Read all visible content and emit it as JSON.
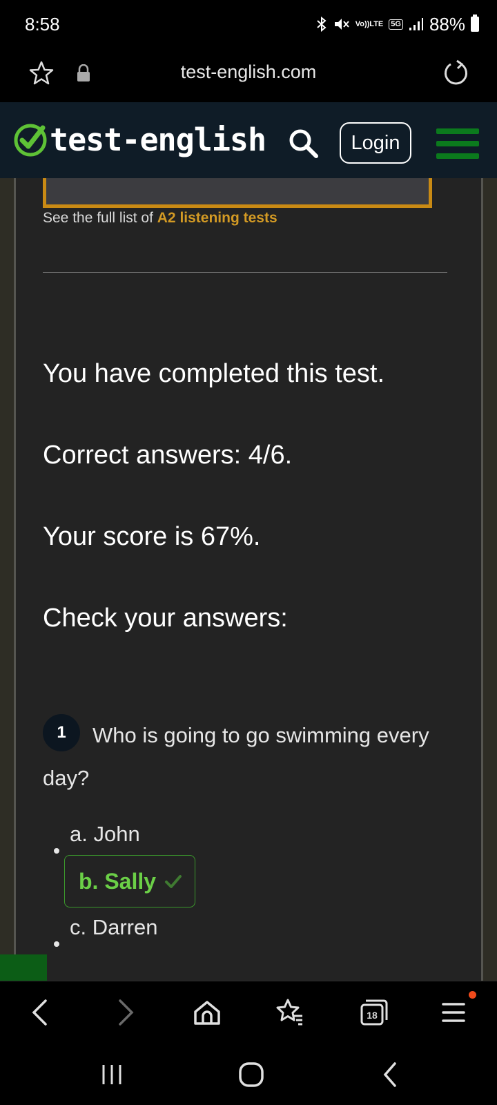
{
  "status_bar": {
    "time": "8:58",
    "volte_line1": "Vo))",
    "volte_line2": "LTE",
    "network": "5G",
    "battery": "88%"
  },
  "browser": {
    "url": "test-english.com",
    "tab_count": "18"
  },
  "header": {
    "logo_text": "test-english",
    "login_label": "Login",
    "accent_color": "#0b7a1d"
  },
  "content": {
    "see_list_prefix": "See the full list of ",
    "see_list_link": "A2 listening tests",
    "completed": "You have completed this test.",
    "correct_answers": "Correct answers: 4/6.",
    "score": "Your score is 67%.",
    "check_answers": "Check your answers:",
    "score_percent": 67
  },
  "question": {
    "number": "1",
    "text": "Who is going to go swimming every day?",
    "options": [
      {
        "label": "a. John",
        "state": "neutral"
      },
      {
        "label": "b. Sally",
        "state": "correct"
      },
      {
        "label": "c. Darren",
        "state": "neutral"
      }
    ]
  },
  "colors": {
    "link": "#d39a24",
    "correct": "#6bcf47",
    "correct_border": "#3b9a2c",
    "notification_dot": "#f04a1b"
  },
  "icons": [
    "bookmark-star-icon",
    "lock-icon",
    "reload-icon",
    "logo-check-icon",
    "search-icon",
    "menu-icon",
    "back-icon",
    "forward-icon",
    "home-icon",
    "bookmarks-icon",
    "tabs-icon",
    "browser-menu-icon",
    "recents-icon",
    "home-circle-icon",
    "system-back-icon"
  ]
}
